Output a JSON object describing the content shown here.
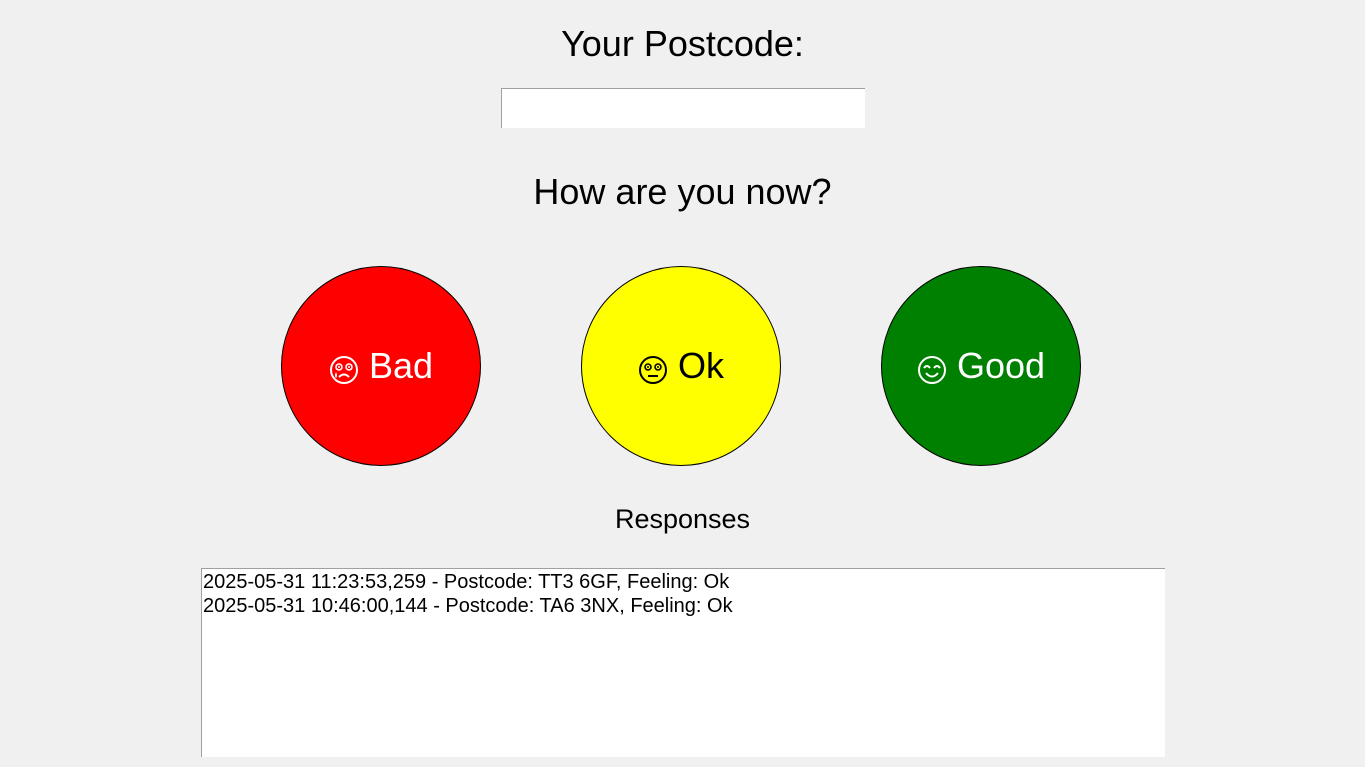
{
  "postcode": {
    "label": "Your Postcode:",
    "value": "",
    "placeholder": ""
  },
  "question": "How are you now?",
  "moods": [
    {
      "label": "Bad",
      "icon": "sad-face-icon",
      "color": "#ff0000",
      "text_color": "#ffffff"
    },
    {
      "label": "Ok",
      "icon": "neutral-face-icon",
      "color": "#ffff00",
      "text_color": "#000000"
    },
    {
      "label": "Good",
      "icon": "happy-face-icon",
      "color": "#008000",
      "text_color": "#ffffff"
    }
  ],
  "responses": {
    "heading": "Responses",
    "lines": [
      "2025-05-31 11:23:53,259 - Postcode: TT3 6GF, Feeling: Ok",
      "2025-05-31 10:46:00,144 - Postcode: TA6 3NX, Feeling: Ok"
    ]
  }
}
